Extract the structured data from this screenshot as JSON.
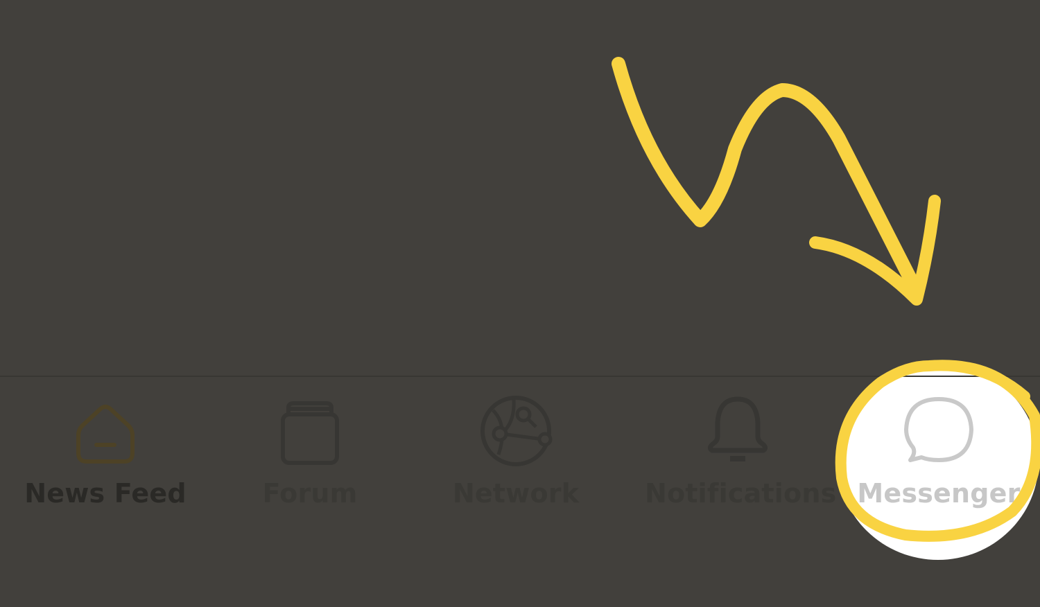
{
  "tabs": [
    {
      "id": "newsfeed",
      "label": "News Feed",
      "icon": "home-icon",
      "active": true,
      "color": "#2a2926"
    },
    {
      "id": "forum",
      "label": "Forum",
      "icon": "forum-icon",
      "active": false,
      "color": "#3a3935"
    },
    {
      "id": "network",
      "label": "Network",
      "icon": "network-icon",
      "active": false,
      "color": "#3a3935"
    },
    {
      "id": "notifications",
      "label": "Notifications",
      "icon": "bell-icon",
      "active": false,
      "color": "#3a3935"
    },
    {
      "id": "messenger",
      "label": "Messenger",
      "icon": "chat-bubble-icon",
      "active": false,
      "highlighted": true,
      "color": "#c7c7c7"
    }
  ],
  "annotation": {
    "arrow": "yellow-arrow-pointing-to-messenger",
    "circle": "yellow-circle-around-messenger",
    "color": "#f9d342"
  },
  "colors": {
    "overlay_background": "#42403c",
    "spotlight": "#ffffff",
    "active_icon": "#4d4226",
    "inactive_icon": "#3a3935",
    "messenger_icon": "#c7c7c7"
  }
}
